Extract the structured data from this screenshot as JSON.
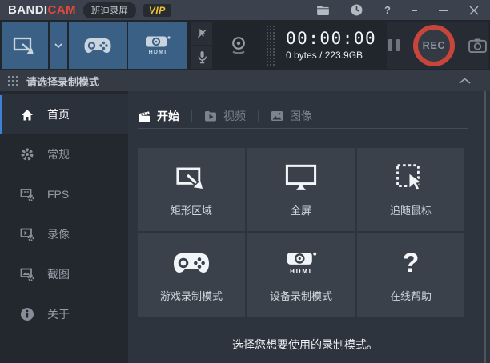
{
  "titlebar": {
    "brand_bandi": "BANDI",
    "brand_cam": "CAM",
    "badge_cn": "班迪录屏",
    "badge_vip": "VIP",
    "help_label": "?"
  },
  "toolbar": {
    "timer": "00:00:00",
    "storage": "0 bytes / 223.9GB",
    "rec_label": "REC",
    "hdmi_label": "HDMI"
  },
  "header": {
    "title": "请选择录制模式"
  },
  "sidebar": {
    "items": [
      {
        "label": "首页",
        "active": true
      },
      {
        "label": "常规",
        "active": false
      },
      {
        "label": "FPS",
        "active": false
      },
      {
        "label": "录像",
        "active": false
      },
      {
        "label": "截图",
        "active": false
      },
      {
        "label": "关于",
        "active": false
      }
    ]
  },
  "tabs": [
    {
      "label": "开始",
      "active": true
    },
    {
      "label": "视频",
      "active": false
    },
    {
      "label": "图像",
      "active": false
    }
  ],
  "modes": [
    {
      "label": "矩形区域"
    },
    {
      "label": "全屏"
    },
    {
      "label": "追随鼠标"
    },
    {
      "label": "游戏录制模式"
    },
    {
      "label": "设备录制模式",
      "icon_label": "HDMI"
    },
    {
      "label": "在线帮助",
      "icon_label": "?"
    }
  ],
  "footer": {
    "hint": "选择您想要使用的录制模式。"
  },
  "colors": {
    "brand_red": "#e2493b",
    "vip_gold": "#f2c230",
    "toolbar_button_blue": "#3b6086",
    "rec_ring_red": "#c7453a",
    "sidebar_active_blue": "#3f7fd6",
    "titlebar_bg": "#3b424d",
    "card_bg": "#3a414b"
  }
}
